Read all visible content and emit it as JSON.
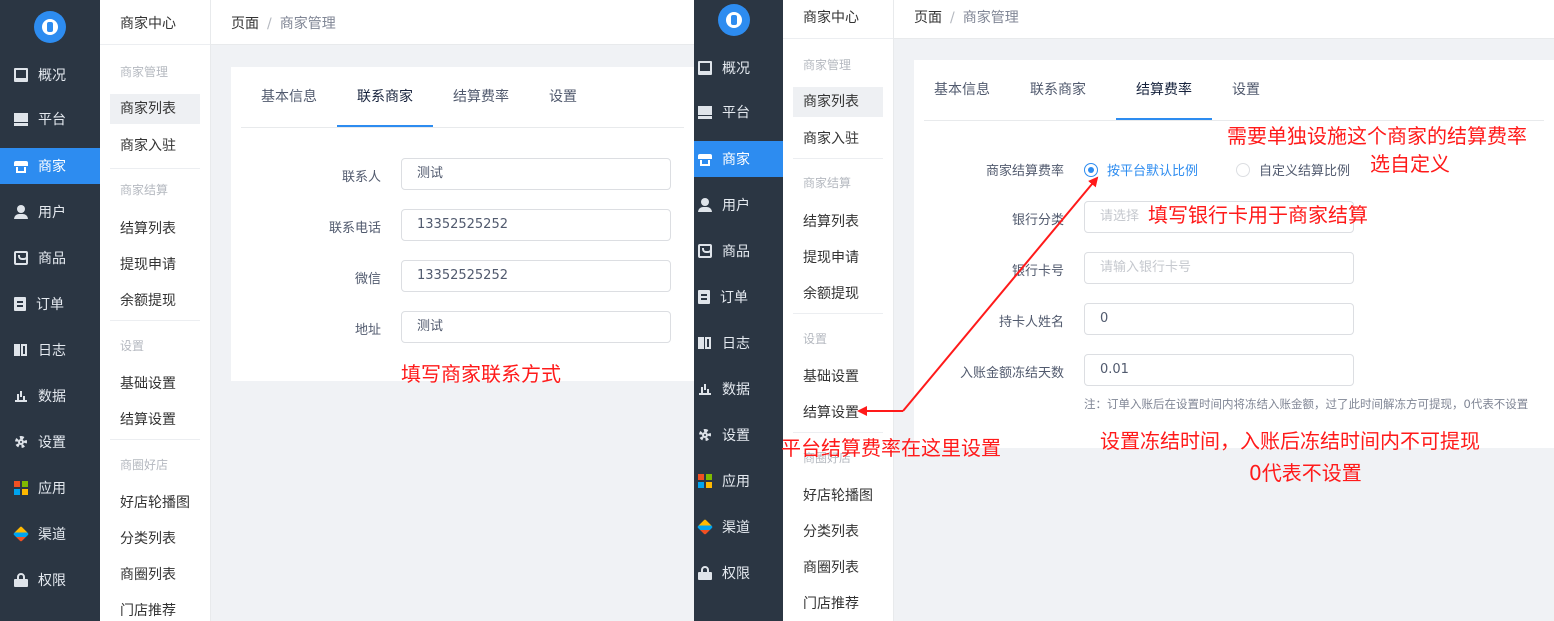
{
  "left": {
    "sidebar": [
      {
        "label": "概况",
        "icon": "monitor-icon"
      },
      {
        "label": "平台",
        "icon": "screen-icon"
      },
      {
        "label": "商家",
        "icon": "shop-icon"
      },
      {
        "label": "用户",
        "icon": "user-icon"
      },
      {
        "label": "商品",
        "icon": "bag-icon"
      },
      {
        "label": "订单",
        "icon": "clipboard-icon"
      },
      {
        "label": "日志",
        "icon": "book-icon"
      },
      {
        "label": "数据",
        "icon": "bar-chart-icon"
      },
      {
        "label": "设置",
        "icon": "gear-icon"
      },
      {
        "label": "应用",
        "icon": "apps-grid-icon"
      },
      {
        "label": "渠道",
        "icon": "cube-icon"
      },
      {
        "label": "权限",
        "icon": "lock-icon"
      }
    ],
    "submenu": {
      "title": "商家中心",
      "group_manage": "商家管理",
      "item_list": "商家列表",
      "item_settle_in": "商家入驻",
      "group_settlement": "商家结算",
      "item_settle_list": "结算列表",
      "item_withdraw_apply": "提现申请",
      "item_balance_withdraw": "余额提现",
      "group_settings": "设置",
      "item_basic_settings": "基础设置",
      "item_settle_settings": "结算设置",
      "group_circle": "商圈好店",
      "item_carousel": "好店轮播图",
      "item_category": "分类列表",
      "item_circle_list": "商圈列表",
      "item_recommend": "门店推荐"
    },
    "breadcrumb": {
      "home": "页面",
      "sep": "/",
      "current": "商家管理"
    },
    "tabs": [
      "基本信息",
      "联系商家",
      "结算费率",
      "设置"
    ],
    "form": {
      "contact_label": "联系人",
      "contact_value": "测试",
      "phone_label": "联系电话",
      "phone_value": "13352525252",
      "wechat_label": "微信",
      "wechat_value": "13352525252",
      "address_label": "地址",
      "address_value": "测试"
    },
    "annotation": "填写商家联系方式"
  },
  "right": {
    "sidebar": [
      {
        "label": "概况",
        "icon": "monitor-icon"
      },
      {
        "label": "平台",
        "icon": "screen-icon"
      },
      {
        "label": "商家",
        "icon": "shop-icon"
      },
      {
        "label": "用户",
        "icon": "user-icon"
      },
      {
        "label": "商品",
        "icon": "bag-icon"
      },
      {
        "label": "订单",
        "icon": "clipboard-icon"
      },
      {
        "label": "日志",
        "icon": "book-icon"
      },
      {
        "label": "数据",
        "icon": "bar-chart-icon"
      },
      {
        "label": "设置",
        "icon": "gear-icon"
      },
      {
        "label": "应用",
        "icon": "apps-grid-icon"
      },
      {
        "label": "渠道",
        "icon": "cube-icon"
      },
      {
        "label": "权限",
        "icon": "lock-icon"
      }
    ],
    "submenu": {
      "title": "商家中心",
      "group_manage": "商家管理",
      "item_list": "商家列表",
      "item_settle_in": "商家入驻",
      "group_settlement": "商家结算",
      "item_settle_list": "结算列表",
      "item_withdraw_apply": "提现申请",
      "item_balance_withdraw": "余额提现",
      "group_settings": "设置",
      "item_basic_settings": "基础设置",
      "item_settle_settings": "结算设置",
      "group_circle": "商圈好店",
      "item_carousel": "好店轮播图",
      "item_category": "分类列表",
      "item_circle_list": "商圈列表",
      "item_recommend": "门店推荐"
    },
    "breadcrumb": {
      "home": "页面",
      "sep": "/",
      "current": "商家管理"
    },
    "tabs": [
      "基本信息",
      "联系商家",
      "结算费率",
      "设置"
    ],
    "form": {
      "rate_label": "商家结算费率",
      "rate_option_default": "按平台默认比例",
      "rate_option_custom": "自定义结算比例",
      "bank_type_label": "银行分类",
      "bank_type_placeholder": "请选择",
      "bank_card_label": "银行卡号",
      "bank_card_placeholder": "请输入银行卡号",
      "holder_label": "持卡人姓名",
      "holder_value": "0",
      "freeze_label": "入账金额冻结天数",
      "freeze_value": "0.01",
      "freeze_note": "注：订单入账后在设置时间内将冻结入账金额，过了此时间解冻方可提现，0代表不设置"
    },
    "annotations": {
      "custom_rate_1": "需要单独设施这个商家的结算费率",
      "custom_rate_2": "选自定义",
      "bank": "填写银行卡用于商家结算",
      "platform": "平台结算费率在这里设置",
      "freeze_1": "设置冻结时间，入账后冻结时间内不可提现",
      "freeze_2": "0代表不设置"
    }
  },
  "colors": {
    "sidebar_bg": "#2b3643",
    "accent": "#2d8cf0",
    "annotation": "#ff1a1a",
    "page_bg": "#f0f2f5"
  }
}
